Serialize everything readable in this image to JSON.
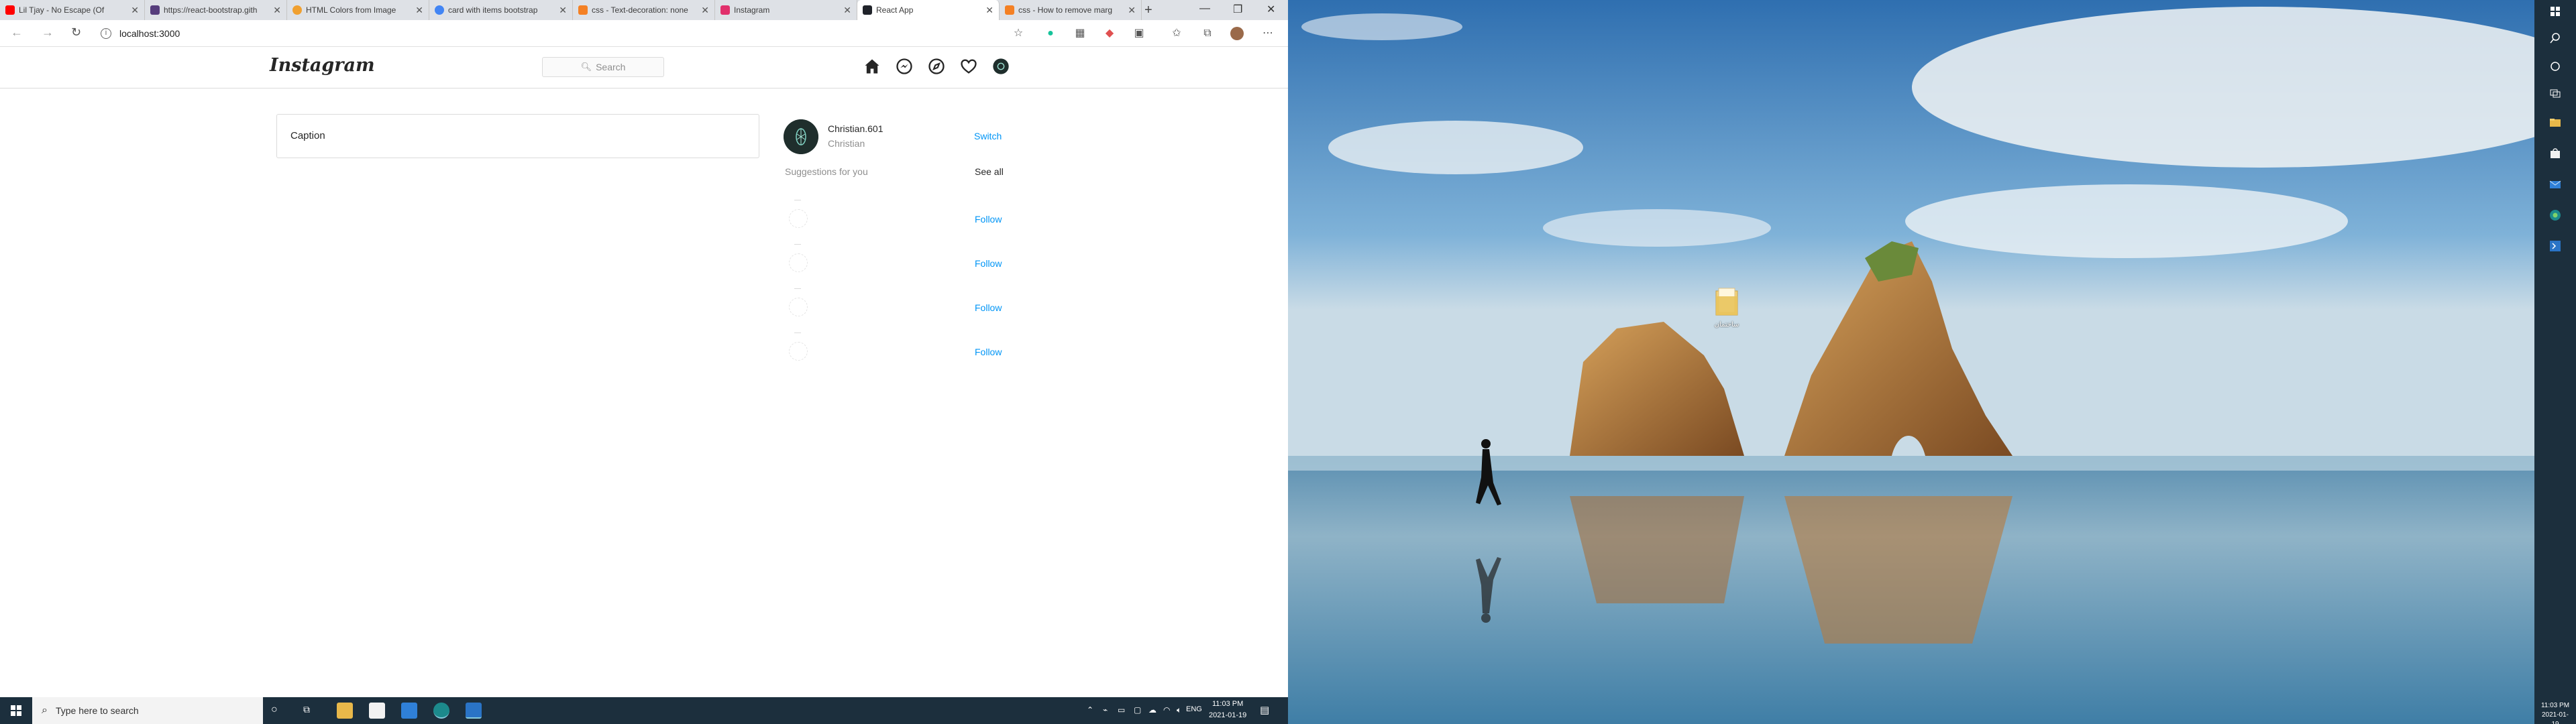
{
  "browser": {
    "tabs": [
      {
        "title": "Lil Tjay - No Escape (Of",
        "fav_color": "#ff0000"
      },
      {
        "title": "https://react-bootstrap.gith",
        "fav_color": "#563d7c"
      },
      {
        "title": "HTML Colors from Image",
        "fav_color": "#f0a030"
      },
      {
        "title": "card with items bootstrap",
        "fav_color": "#4285f4"
      },
      {
        "title": "css - Text-decoration: none",
        "fav_color": "#f48024"
      },
      {
        "title": "Instagram",
        "fav_color": "#e1306c"
      },
      {
        "title": "React App",
        "fav_color": "#20232a"
      },
      {
        "title": "css - How to remove marg",
        "fav_color": "#f48024"
      }
    ],
    "url": "localhost:3000"
  },
  "instagram": {
    "logo": "Instagram",
    "search_placeholder": "Search",
    "caption_placeholder": "Caption",
    "profile": {
      "username": "Christian.601",
      "name": "Christian"
    },
    "switch_label": "Switch",
    "suggestions_title": "Suggestions for you",
    "see_all_label": "See all",
    "suggestions": [
      {
        "follow_label": "Follow"
      },
      {
        "follow_label": "Follow"
      },
      {
        "follow_label": "Follow"
      },
      {
        "follow_label": "Follow"
      }
    ]
  },
  "taskbar": {
    "search_placeholder": "Type here to search",
    "language": "ENG",
    "time": "11:03 PM",
    "date": "2021-01-19"
  },
  "desktop": {
    "folder_label": "ساختمان",
    "time": "11:03 PM",
    "date": "2021-01-19"
  },
  "colors": {
    "link_blue": "#0095f6",
    "taskbar": "#1c2f3d",
    "tab_bar": "#dee1e6"
  }
}
